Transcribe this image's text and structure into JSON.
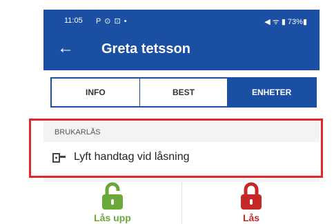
{
  "status_bar": {
    "time": "11:05",
    "left_icons": "P ⊙ ⊡ •",
    "right_icons": "◀ ᯤ ▮ 73%▮"
  },
  "app_bar": {
    "back_icon": "arrow-back-icon",
    "title": "Greta tetsson"
  },
  "tabs": [
    {
      "label": "INFO",
      "active": false
    },
    {
      "label": "BEST",
      "active": false
    },
    {
      "label": "ENHETER",
      "active": true
    }
  ],
  "section": {
    "header": "BRUKARLÅS",
    "item": {
      "icon": "door-handle-icon",
      "label": "Lyft handtag vid låsning"
    }
  },
  "actions": [
    {
      "label": "Lås upp",
      "icon": "unlocked-padlock-icon",
      "color": "#6aa83a"
    },
    {
      "label": "Lås",
      "icon": "locked-padlock-icon",
      "color": "#c62828"
    }
  ],
  "colors": {
    "primary": "#1a4fa3",
    "highlight": "#e0282c"
  }
}
